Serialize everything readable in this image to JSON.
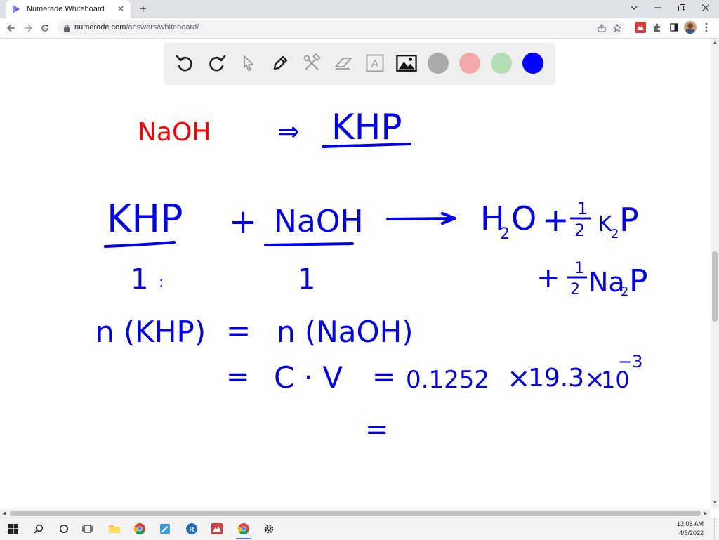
{
  "browser": {
    "tab_title": "Numerade Whiteboard",
    "url_host": "numerade.com",
    "url_path": "/answers/whiteboard/",
    "new_tab_symbol": "+",
    "close_symbol": "✕"
  },
  "whiteboard": {
    "tools": [
      "undo-icon",
      "redo-icon",
      "select-icon",
      "pen-icon",
      "tools-icon",
      "eraser-icon",
      "text-icon",
      "image-icon"
    ],
    "text_tool_letter": "A",
    "colors": {
      "gray": "#aaaaaa",
      "pink": "#f4a9a9",
      "green": "#b6dcb6",
      "blue": "#0000ff",
      "ink_red": "#ff0000",
      "ink_blue": "#0000ee"
    },
    "content": {
      "line1_reactant": "NaOH",
      "line1_arrow": "⇒",
      "line1_product": "KHP",
      "eq_reactant1": "KHP",
      "eq_plus1": "+",
      "eq_reactant2": "NaOH",
      "eq_product1": "H",
      "eq_product1_sub": "2",
      "eq_product1_o": "O",
      "eq_plus2": "+",
      "frac_num": "1",
      "frac_den": "2",
      "eq_product2": "K",
      "eq_product2_sub": "2",
      "eq_product2_p": "P",
      "ratio_left": "1",
      "ratio_colon": ":",
      "ratio_right": "1",
      "line3_plus": "+",
      "line3_product": "Na",
      "line3_sub": "2",
      "line3_p": "P",
      "n_left": "n (KHP)",
      "eq_sign1": "=",
      "n_right": "n (NaOH)",
      "eq_sign2": "=",
      "cv_expr": "C · V",
      "eq_sign3": "=",
      "value_c": "0.1252",
      "times1": "×",
      "value_v": "19.3",
      "times2": "×",
      "ten": "10",
      "exponent": "−3",
      "eq_sign4": "="
    }
  },
  "taskbar": {
    "time": "12:08 AM",
    "date": "4/5/2022"
  }
}
